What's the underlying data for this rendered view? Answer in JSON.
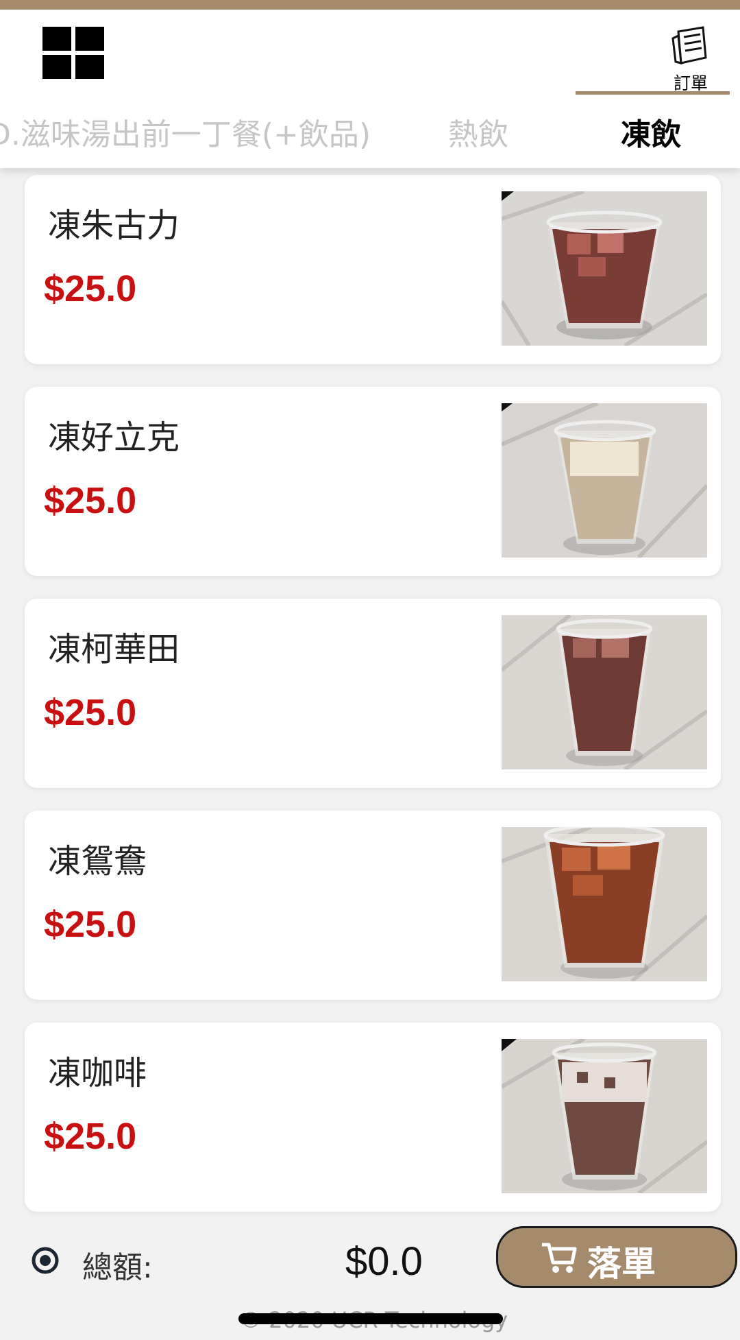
{
  "header": {
    "menu_icon": "grid-icon",
    "order_icon": "receipt-icon",
    "order_label": "訂單"
  },
  "tabs": [
    {
      "label": "D.滋味湯出前一丁餐(+飲品)",
      "active": false
    },
    {
      "label": "熱飲",
      "active": false
    },
    {
      "label": "凍飲",
      "active": true
    }
  ],
  "items": [
    {
      "name": "凍朱古力",
      "price": "$25.0"
    },
    {
      "name": "凍好立克",
      "price": "$25.0"
    },
    {
      "name": "凍柯華田",
      "price": "$25.0"
    },
    {
      "name": "凍鴛鴦",
      "price": "$25.0"
    },
    {
      "name": "凍咖啡",
      "price": "$25.0"
    }
  ],
  "footer": {
    "total_label": "總額:",
    "total_value": "$0.0",
    "submit_label": "落單",
    "copyright": "© 2020 UCR Technology"
  },
  "colors": {
    "accent": "#a58a6c",
    "price": "#c81010"
  }
}
